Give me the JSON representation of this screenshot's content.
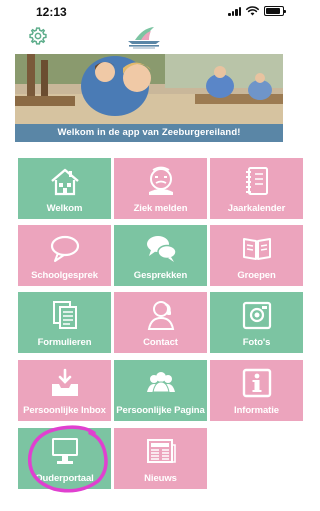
{
  "status_bar": {
    "time": "12:13",
    "battery_level": 0.85
  },
  "header": {
    "settings_icon": "gear-icon",
    "logo": "zeeburgereiland-logo"
  },
  "banner": {
    "caption": "Welkom in de app van Zeeburgereiland!"
  },
  "tiles": [
    {
      "label": "Welkom",
      "icon": "house-icon",
      "color": "green"
    },
    {
      "label": "Ziek melden",
      "icon": "sick-face-icon",
      "color": "pink"
    },
    {
      "label": "Jaarkalender",
      "icon": "notebook-icon",
      "color": "pink"
    },
    {
      "label": "Schoolgesprek",
      "icon": "speech-bubble-icon",
      "color": "pink"
    },
    {
      "label": "Gesprekken",
      "icon": "chat-bubbles-icon",
      "color": "green"
    },
    {
      "label": "Groepen",
      "icon": "open-book-icon",
      "color": "pink"
    },
    {
      "label": "Formulieren",
      "icon": "documents-icon",
      "color": "green"
    },
    {
      "label": "Contact",
      "icon": "phone-person-icon",
      "color": "pink"
    },
    {
      "label": "Foto's",
      "icon": "camera-icon",
      "color": "green"
    },
    {
      "label": "Persoonlijke Inbox",
      "icon": "inbox-icon",
      "color": "pink"
    },
    {
      "label": "Persoonlijke Pagina",
      "icon": "people-icon",
      "color": "green"
    },
    {
      "label": "Informatie",
      "icon": "info-icon",
      "color": "pink"
    },
    {
      "label": "Ouderportaal",
      "icon": "monitor-icon",
      "color": "green"
    },
    {
      "label": "Nieuws",
      "icon": "newspaper-icon",
      "color": "pink"
    }
  ],
  "colors": {
    "green": "#7cc4a2",
    "pink": "#eca4bd",
    "caption": "#5a86a6",
    "annotation": "#e040d0"
  }
}
